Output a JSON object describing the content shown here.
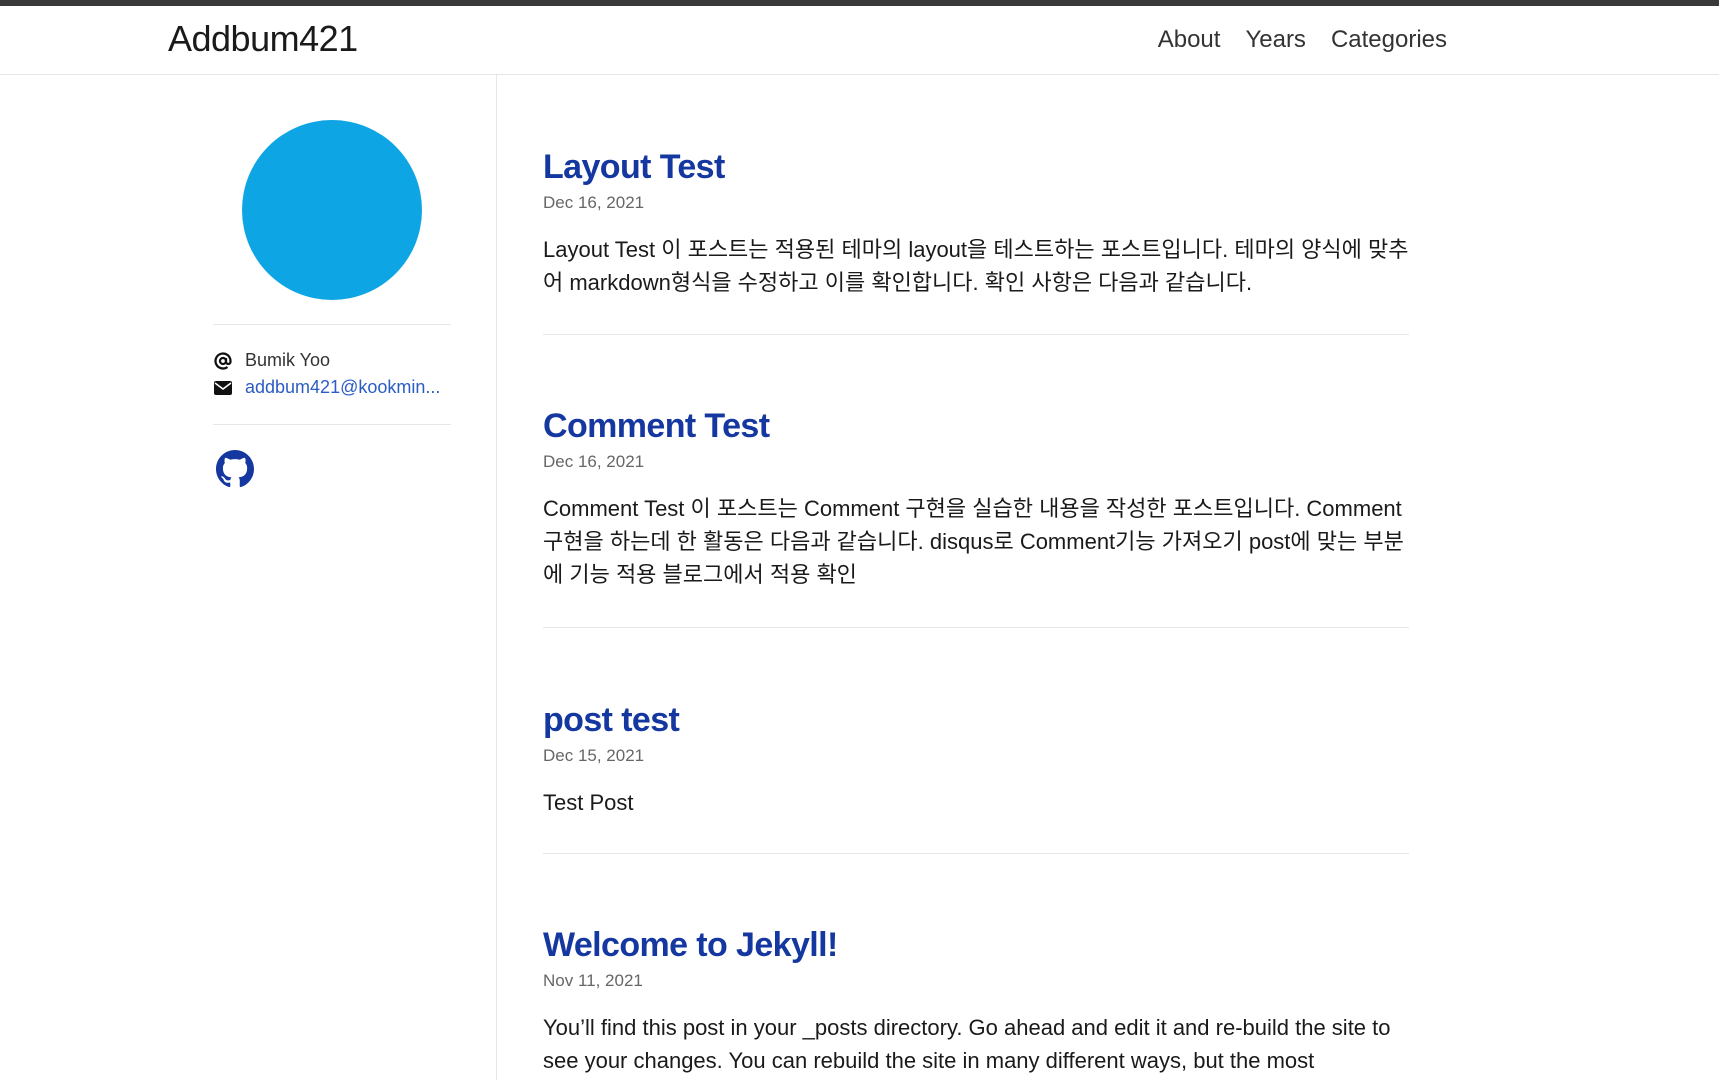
{
  "header": {
    "site_title": "Addbum421",
    "nav": [
      "About",
      "Years",
      "Categories"
    ]
  },
  "sidebar": {
    "author_name": "Bumik Yoo",
    "email": "addbum421@kookmin...",
    "icons": [
      "at-icon",
      "envelope-icon",
      "github-icon"
    ],
    "avatar_color": "#0ea5e4"
  },
  "posts": [
    {
      "title": "Layout Test",
      "date": "Dec 16, 2021",
      "excerpt": "Layout Test 이 포스트는 적용된 테마의 layout을 테스트하는 포스트입니다. 테마의 양식에 맞추어 markdown형식을 수정하고 이를 확인합니다. 확인 사항은 다음과 같습니다."
    },
    {
      "title": "Comment Test",
      "date": "Dec 16, 2021",
      "excerpt": "Comment Test 이 포스트는 Comment 구현을 실습한 내용을 작성한 포스트입니다. Comment 구현을 하는데 한 활동은 다음과 같습니다. disqus로 Comment기능 가져오기 post에 맞는 부분에 기능 적용 블로그에서 적용 확인"
    },
    {
      "title": "post test",
      "date": "Dec 15, 2021",
      "excerpt": "Test Post"
    },
    {
      "title": "Welcome to Jekyll!",
      "date": "Nov 11, 2021",
      "excerpt": "You’ll find this post in your _posts directory. Go ahead and edit it and re-build the site to see your changes. You can rebuild the site in many different ways, but the most"
    }
  ],
  "colors": {
    "link": "#1537a0",
    "email_link": "#2b5cc4",
    "top_strip": "#3a3a3a"
  }
}
